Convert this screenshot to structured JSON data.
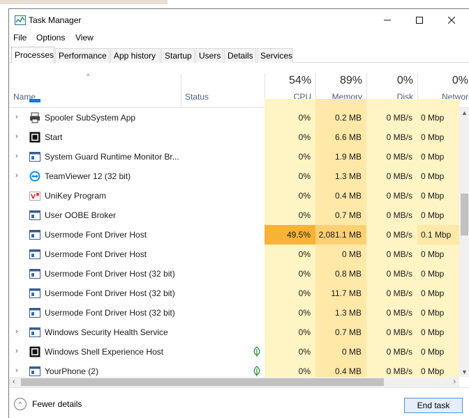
{
  "window": {
    "title": "Task Manager"
  },
  "menu": {
    "items": [
      "File",
      "Options",
      "View"
    ]
  },
  "tabs": [
    "Processes",
    "Performance",
    "App history",
    "Startup",
    "Users",
    "Details",
    "Services"
  ],
  "active_tab": "Processes",
  "header": {
    "name_label": "Name",
    "status_label": "Status",
    "metrics": [
      {
        "pct": "54%",
        "label": "CPU"
      },
      {
        "pct": "89%",
        "label": "Memory"
      },
      {
        "pct": "0%",
        "label": "Disk"
      },
      {
        "pct": "0%",
        "label": "Network"
      }
    ]
  },
  "rows": [
    {
      "name": "Spooler SubSystem App",
      "icon": "printer-icon",
      "expandable": true,
      "status_icon": "",
      "cpu": "0%",
      "mem": "0.2 MB",
      "disk": "0 MB/s",
      "net": "0 Mbp",
      "hot": false
    },
    {
      "name": "Start",
      "icon": "app-window-icon",
      "expandable": true,
      "status_icon": "",
      "cpu": "0%",
      "mem": "6.6 MB",
      "disk": "0 MB/s",
      "net": "0 Mbp",
      "hot": false
    },
    {
      "name": "System Guard Runtime Monitor Br...",
      "icon": "service-window-icon",
      "expandable": true,
      "status_icon": "",
      "cpu": "0%",
      "mem": "1.9 MB",
      "disk": "0 MB/s",
      "net": "0 Mbp",
      "hot": false
    },
    {
      "name": "TeamViewer 12 (32 bit)",
      "icon": "teamviewer-icon",
      "expandable": true,
      "status_icon": "",
      "cpu": "0%",
      "mem": "1.3 MB",
      "disk": "0 MB/s",
      "net": "0 Mbp",
      "hot": false
    },
    {
      "name": "UniKey Program",
      "icon": "unikey-icon",
      "expandable": false,
      "status_icon": "",
      "cpu": "0%",
      "mem": "0.4 MB",
      "disk": "0 MB/s",
      "net": "0 Mbp",
      "hot": false
    },
    {
      "name": "User OOBE Broker",
      "icon": "service-window-icon",
      "expandable": false,
      "status_icon": "",
      "cpu": "0%",
      "mem": "0.7 MB",
      "disk": "0 MB/s",
      "net": "0 Mbp",
      "hot": false
    },
    {
      "name": "Usermode Font Driver Host",
      "icon": "service-window-icon",
      "expandable": false,
      "status_icon": "",
      "cpu": "49.5%",
      "mem": "2,081.1 MB",
      "disk": "0 MB/s",
      "net": "0.1 Mbp",
      "hot": true
    },
    {
      "name": "Usermode Font Driver Host",
      "icon": "service-window-icon",
      "expandable": false,
      "status_icon": "",
      "cpu": "0%",
      "mem": "0 MB",
      "disk": "0 MB/s",
      "net": "0 Mbp",
      "hot": false
    },
    {
      "name": "Usermode Font Driver Host (32 bit)",
      "icon": "service-window-icon",
      "expandable": false,
      "status_icon": "",
      "cpu": "0%",
      "mem": "0.8 MB",
      "disk": "0 MB/s",
      "net": "0 Mbp",
      "hot": false
    },
    {
      "name": "Usermode Font Driver Host (32 bit)",
      "icon": "service-window-icon",
      "expandable": false,
      "status_icon": "",
      "cpu": "0%",
      "mem": "11.7 MB",
      "disk": "0 MB/s",
      "net": "0 Mbp",
      "hot": false
    },
    {
      "name": "Usermode Font Driver Host (32 bit)",
      "icon": "service-window-icon",
      "expandable": false,
      "status_icon": "",
      "cpu": "0%",
      "mem": "1.3 MB",
      "disk": "0 MB/s",
      "net": "0 Mbp",
      "hot": false
    },
    {
      "name": "Windows Security Health Service",
      "icon": "service-window-icon",
      "expandable": true,
      "status_icon": "",
      "cpu": "0%",
      "mem": "0.7 MB",
      "disk": "0 MB/s",
      "net": "0 Mbp",
      "hot": false
    },
    {
      "name": "Windows Shell Experience Host",
      "icon": "app-window-icon",
      "expandable": true,
      "status_icon": "leaf-icon",
      "cpu": "0%",
      "mem": "0 MB",
      "disk": "0 MB/s",
      "net": "0 Mbp",
      "hot": false
    },
    {
      "name": "YourPhone (2)",
      "icon": "service-window-icon",
      "expandable": true,
      "status_icon": "leaf-icon",
      "cpu": "0%",
      "mem": "0.4 MB",
      "disk": "0 MB/s",
      "net": "0 Mbp",
      "hot": false
    }
  ],
  "footer": {
    "fewer_details": "Fewer details",
    "end_task": "End task"
  }
}
